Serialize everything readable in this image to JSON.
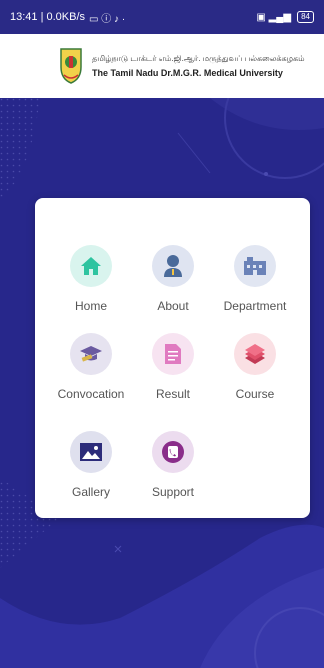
{
  "status_bar": {
    "left_text": "13:41 | 0.0KB/s",
    "battery": "84"
  },
  "header": {
    "title_tamil": "தமிழ்நாடு டாக்டர் எம்.ஜி.ஆர். மருத்துவப் பல்கலைக்கழகம்",
    "title_english": "The Tamil Nadu Dr.M.G.R. Medical University"
  },
  "menu": [
    {
      "label": "Home",
      "icon": "home-icon",
      "color": "#2ec4a0"
    },
    {
      "label": "About",
      "icon": "person-icon",
      "color": "#4a6a9a"
    },
    {
      "label": "Department",
      "icon": "building-icon",
      "color": "#6a82b8"
    },
    {
      "label": "Convocation",
      "icon": "graduation-cap-icon",
      "color": "#6a5aa0"
    },
    {
      "label": "Result",
      "icon": "document-icon",
      "color": "#e07ac0"
    },
    {
      "label": "Course",
      "icon": "books-icon",
      "color": "#e0506a"
    },
    {
      "label": "Gallery",
      "icon": "image-icon",
      "color": "#2c2c7a"
    },
    {
      "label": "Support",
      "icon": "phone-icon",
      "color": "#8a2d8a"
    }
  ]
}
